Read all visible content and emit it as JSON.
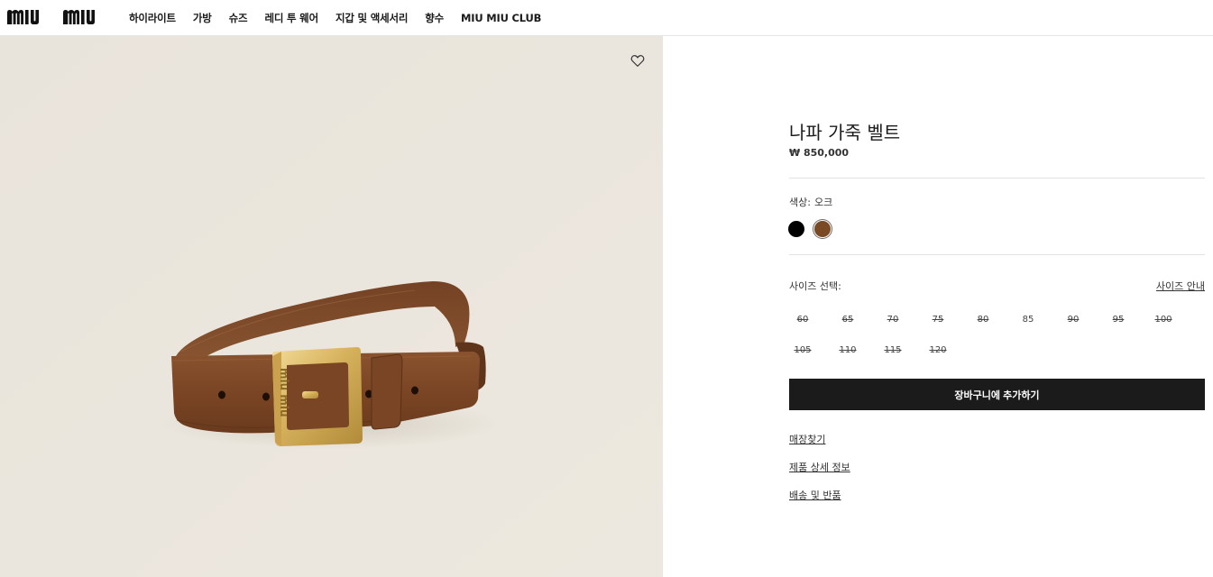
{
  "header": {
    "logo_text": "MIU MIU",
    "nav": [
      "하이라이트",
      "가방",
      "슈즈",
      "레디 투 웨어",
      "지갑 및 액세서리",
      "향수",
      "MIU MIU CLUB"
    ]
  },
  "image": {
    "alt_icon": "heart-icon",
    "buckle_text": "miu miu"
  },
  "product": {
    "title": "나파 가죽 벨트",
    "price": "₩ 850,000",
    "color_label": "색상:",
    "color_value": "오크",
    "colors": [
      {
        "name": "black",
        "hex": "#000000"
      },
      {
        "name": "oak",
        "hex": "#7a4a24",
        "selected": true
      }
    ],
    "size_label": "사이즈 선택:",
    "size_guide": "사이즈 안내",
    "sizes": [
      {
        "label": "60",
        "available": false
      },
      {
        "label": "65",
        "available": false
      },
      {
        "label": "70",
        "available": false
      },
      {
        "label": "75",
        "available": false
      },
      {
        "label": "80",
        "available": false
      },
      {
        "label": "85",
        "available": true
      },
      {
        "label": "90",
        "available": false
      },
      {
        "label": "95",
        "available": false
      },
      {
        "label": "100",
        "available": false
      },
      {
        "label": "105",
        "available": false
      },
      {
        "label": "110",
        "available": false
      },
      {
        "label": "115",
        "available": false
      },
      {
        "label": "120",
        "available": false
      }
    ],
    "add_to_cart": "장바구니에 추가하기",
    "links": [
      "매장찾기",
      "제품 상세 정보",
      "배송 및 반품"
    ]
  }
}
